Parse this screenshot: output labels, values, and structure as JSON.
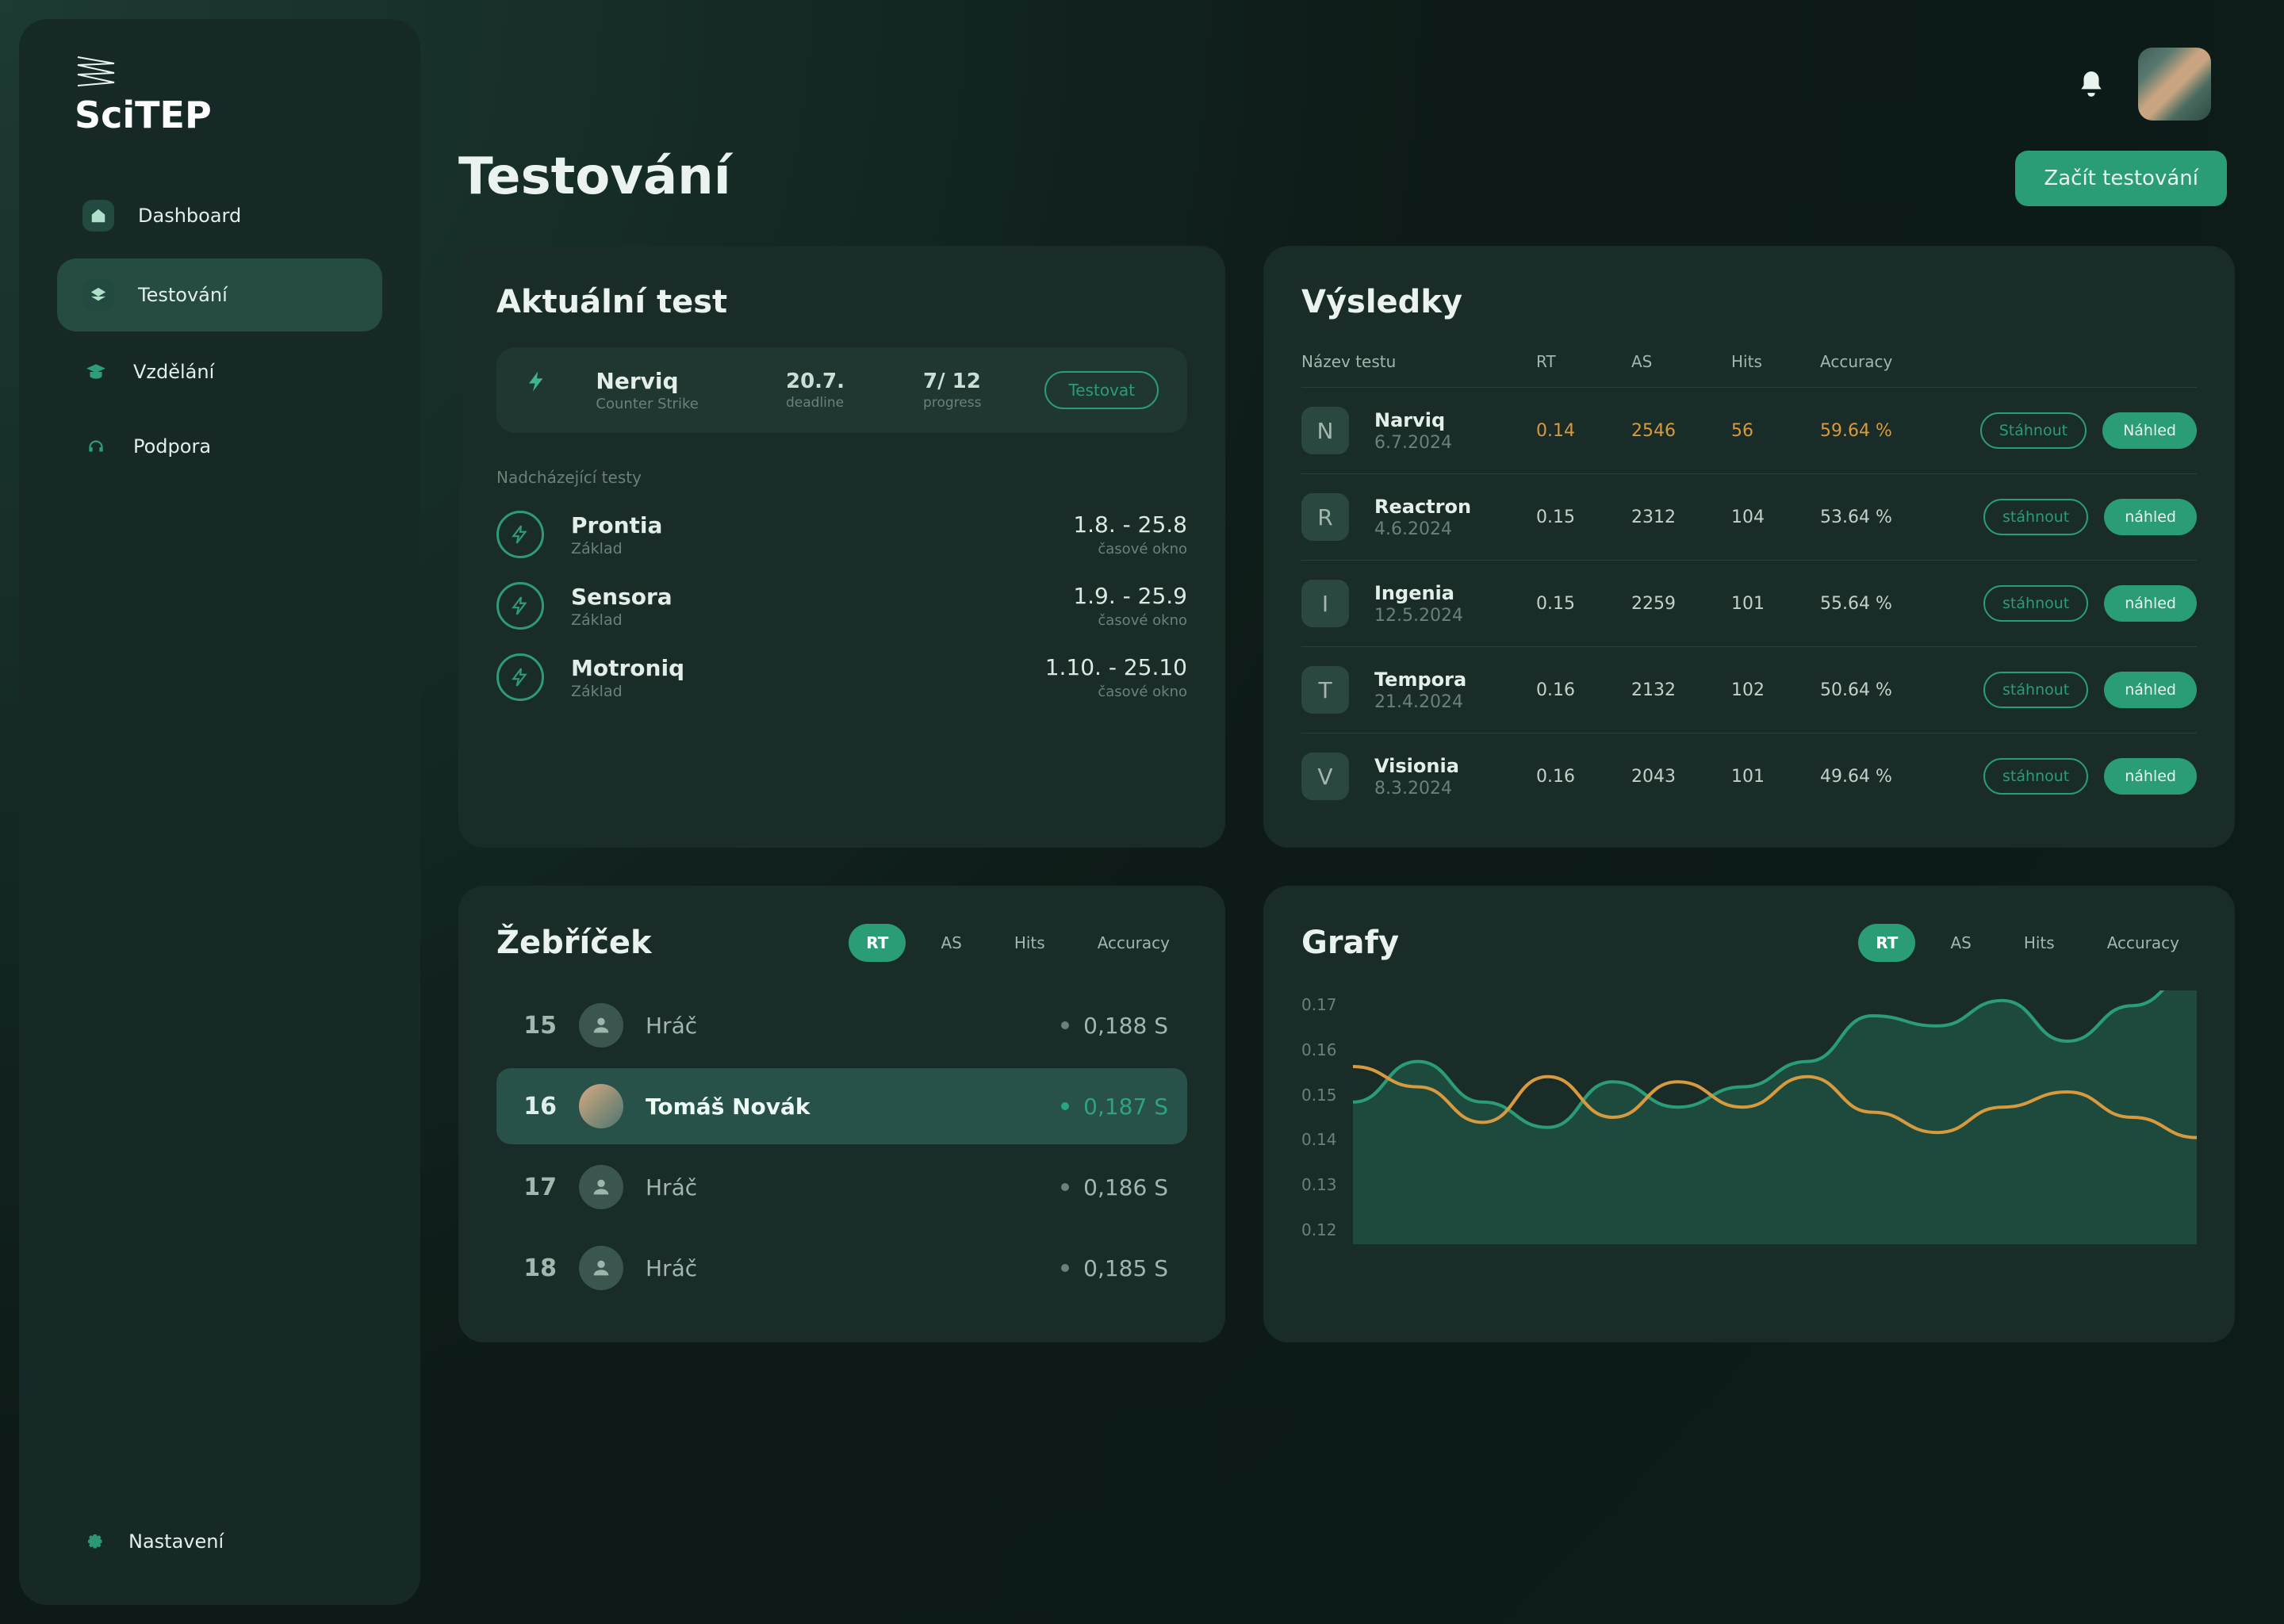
{
  "brand": {
    "name": "SciTEP"
  },
  "sidebar": {
    "items": [
      {
        "label": "Dashboard"
      },
      {
        "label": "Testování"
      },
      {
        "label": "Vzdělání"
      },
      {
        "label": "Podpora"
      }
    ],
    "settings_label": "Nastavení"
  },
  "header": {
    "title": "Testování",
    "primary_button": "Začít testování"
  },
  "current_test": {
    "card_title": "Aktuální test",
    "name": "Nerviq",
    "subtitle": "Counter Strike",
    "deadline": "20.7.",
    "deadline_label": "deadline",
    "progress": "7/ 12",
    "progress_label": "progress",
    "action": "Testovat",
    "upcoming_label": "Nadcházející testy",
    "upcoming": [
      {
        "name": "Prontia",
        "sub": "Základ",
        "range": "1.8. - 25.8",
        "range_label": "časové okno"
      },
      {
        "name": "Sensora",
        "sub": "Základ",
        "range": "1.9. - 25.9",
        "range_label": "časové okno"
      },
      {
        "name": "Motroniq",
        "sub": "Základ",
        "range": "1.10. - 25.10",
        "range_label": "časové okno"
      }
    ]
  },
  "results": {
    "card_title": "Výsledky",
    "columns": {
      "name": "Název testu",
      "rt": "RT",
      "as": "AS",
      "hits": "Hits",
      "acc": "Accuracy"
    },
    "rows": [
      {
        "letter": "N",
        "name": "Narviq",
        "date": "6.7.2024",
        "rt": "0.14",
        "as": "2546",
        "hits": "56",
        "acc": "59.64 %",
        "btn_dl": "Stáhnout",
        "btn_pv": "Náhled",
        "highlight": true
      },
      {
        "letter": "R",
        "name": "Reactron",
        "date": "4.6.2024",
        "rt": "0.15",
        "as": "2312",
        "hits": "104",
        "acc": "53.64 %",
        "btn_dl": "stáhnout",
        "btn_pv": "náhled"
      },
      {
        "letter": "I",
        "name": "Ingenia",
        "date": "12.5.2024",
        "rt": "0.15",
        "as": "2259",
        "hits": "101",
        "acc": "55.64 %",
        "btn_dl": "stáhnout",
        "btn_pv": "náhled"
      },
      {
        "letter": "T",
        "name": "Tempora",
        "date": "21.4.2024",
        "rt": "0.16",
        "as": "2132",
        "hits": "102",
        "acc": "50.64 %",
        "btn_dl": "stáhnout",
        "btn_pv": "náhled"
      },
      {
        "letter": "V",
        "name": "Visionia",
        "date": "8.3.2024",
        "rt": "0.16",
        "as": "2043",
        "hits": "101",
        "acc": "49.64 %",
        "btn_dl": "stáhnout",
        "btn_pv": "náhled"
      }
    ]
  },
  "leaderboard": {
    "card_title": "Žebříček",
    "filters": [
      "RT",
      "AS",
      "Hits",
      "Accuracy"
    ],
    "active_filter": 0,
    "rows": [
      {
        "rank": "15",
        "name": "Hráč",
        "score": "0,188 S"
      },
      {
        "rank": "16",
        "name": "Tomáš Novák",
        "score": "0,187 S",
        "me": true
      },
      {
        "rank": "17",
        "name": "Hráč",
        "score": "0,186 S"
      },
      {
        "rank": "18",
        "name": "Hráč",
        "score": "0,185 S"
      }
    ]
  },
  "graphs": {
    "card_title": "Grafy",
    "filters": [
      "RT",
      "AS",
      "Hits",
      "Accuracy"
    ],
    "active_filter": 0,
    "y_ticks": [
      "0.17",
      "0.16",
      "0.15",
      "0.14",
      "0.13",
      "0.12"
    ]
  },
  "chart_data": {
    "type": "line",
    "ylim": [
      0.12,
      0.17
    ],
    "x_count": 14,
    "series": [
      {
        "name": "series-green",
        "color": "#2a9c76",
        "area": true,
        "values": [
          0.148,
          0.156,
          0.148,
          0.143,
          0.152,
          0.147,
          0.151,
          0.156,
          0.165,
          0.163,
          0.168,
          0.16,
          0.167,
          0.174
        ]
      },
      {
        "name": "series-orange",
        "color": "#d79a3e",
        "area": false,
        "values": [
          0.155,
          0.151,
          0.144,
          0.153,
          0.145,
          0.152,
          0.147,
          0.153,
          0.146,
          0.142,
          0.147,
          0.15,
          0.145,
          0.141
        ]
      }
    ]
  },
  "colors": {
    "accent": "#2a9c76",
    "orange": "#d79a3e"
  }
}
